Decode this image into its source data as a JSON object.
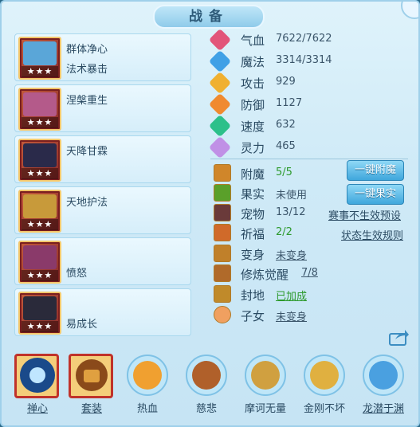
{
  "title": "战备",
  "skills": [
    {
      "line1": "群体净心",
      "line2": "法术暴击",
      "stars": "★★★",
      "art": "#5aa6d8"
    },
    {
      "line1": "涅槃重生",
      "line2": "",
      "stars": "★★★",
      "art": "#b45a8a"
    },
    {
      "line1": "天降甘霖",
      "line2": "",
      "stars": "★★★",
      "art": "#2a2a4a"
    },
    {
      "line1": "天地护法",
      "line2": "",
      "stars": "★★★",
      "art": "#c89a3a"
    },
    {
      "line1": "",
      "line2": "愤怒",
      "stars": "★★★",
      "art": "#8a3a6a"
    },
    {
      "line1": "",
      "line2": "易成长",
      "stars": "★★★",
      "art": "#2a2a3a"
    }
  ],
  "stats": [
    {
      "label": "气血",
      "value": "7622/7622",
      "color": "#e2557a",
      "icon": "heart-icon"
    },
    {
      "label": "魔法",
      "value": "3314/3314",
      "color": "#3fa0e6",
      "icon": "mana-icon"
    },
    {
      "label": "攻击",
      "value": "929",
      "color": "#f0b030",
      "icon": "attack-icon"
    },
    {
      "label": "防御",
      "value": "1127",
      "color": "#f08a30",
      "icon": "shield-icon"
    },
    {
      "label": "速度",
      "value": "632",
      "color": "#2cc08a",
      "icon": "speed-icon"
    },
    {
      "label": "灵力",
      "value": "465",
      "color": "#c090e6",
      "icon": "spirit-icon"
    }
  ],
  "rows": [
    {
      "label": "附魔",
      "value": "5/5",
      "value_style": "green",
      "icon": "enchant-icon",
      "color": "#d0862a"
    },
    {
      "label": "果实",
      "value": "未使用",
      "value_style": "",
      "icon": "fruit-icon",
      "color": "#5aa02a"
    },
    {
      "label": "宠物",
      "value": "13/12",
      "value_style": "",
      "icon": "pet-icon",
      "color": "#6a3a3a"
    },
    {
      "label": "祈福",
      "value": "2/2",
      "value_style": "green",
      "icon": "blessing-icon",
      "color": "#d06a2a"
    },
    {
      "label": "变身",
      "value": "未变身",
      "value_style": "u",
      "icon": "transform-icon",
      "color": "#c0802a"
    },
    {
      "label": "修炼觉醒",
      "value": "7/8",
      "value_style": "u",
      "icon": "cultivate-icon",
      "color": "#b06a2a"
    },
    {
      "label": "封地",
      "value": "已加成",
      "value_style": "green u",
      "icon": "fief-icon",
      "color": "#c08a2a"
    },
    {
      "label": "子女",
      "value": "未变身",
      "value_style": "u",
      "icon": "child-icon",
      "color": "#f0a060"
    }
  ],
  "buttons": {
    "enchant": "一键附魔",
    "fruit": "一键果实"
  },
  "links": {
    "preset": "赛事不生效预设",
    "rules": "状态生效规则"
  },
  "bottom": [
    {
      "label": "禅心",
      "selected": true,
      "color": "#3a8ad0"
    },
    {
      "label": "套装",
      "selected": true,
      "color": "#c0802a"
    },
    {
      "label": "热血",
      "selected": false,
      "color": "#f0a030"
    },
    {
      "label": "慈悲",
      "selected": false,
      "color": "#b0602a"
    },
    {
      "label": "摩诃无量",
      "selected": false,
      "color": "#d0a040"
    },
    {
      "label": "金刚不坏",
      "selected": false,
      "color": "#e0b040"
    },
    {
      "label": "龙潜于渊",
      "selected": false,
      "color": "#4aa0e0"
    }
  ]
}
